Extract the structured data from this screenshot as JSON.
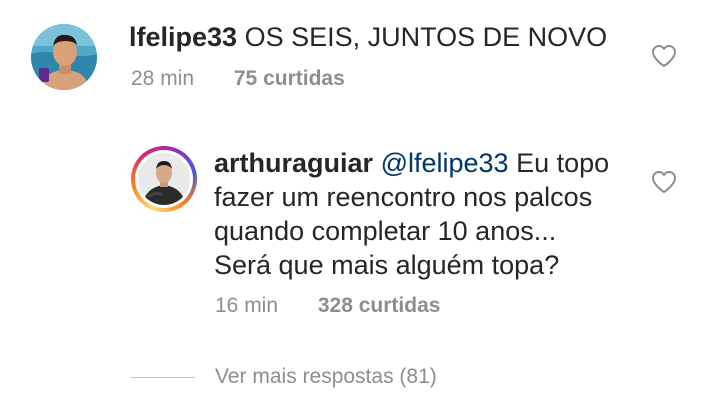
{
  "comment": {
    "username": "lfelipe33",
    "text": "OS SEIS, JUNTOS DE NOVO",
    "time": "28 min",
    "likes": "75 curtidas",
    "like_icon": "heart-outline-icon"
  },
  "reply": {
    "username": "arthuraguiar",
    "mention": "@lfelipe33",
    "line1": "Eu topo",
    "line2": "fazer um reencontro nos palcos",
    "line3": "quando completar 10 anos...",
    "line4": "Será que mais alguém topa?",
    "time": "16 min",
    "likes": "328 curtidas",
    "like_icon": "heart-outline-icon",
    "story_ring_colors": [
      "#feda75",
      "#fa7e1e",
      "#d62976",
      "#962fbf",
      "#4f5bd5"
    ]
  },
  "view_more": {
    "label": "Ver mais respostas (81)"
  },
  "colors": {
    "text": "#262626",
    "secondary": "#8e8e8e",
    "mention": "#003569"
  }
}
